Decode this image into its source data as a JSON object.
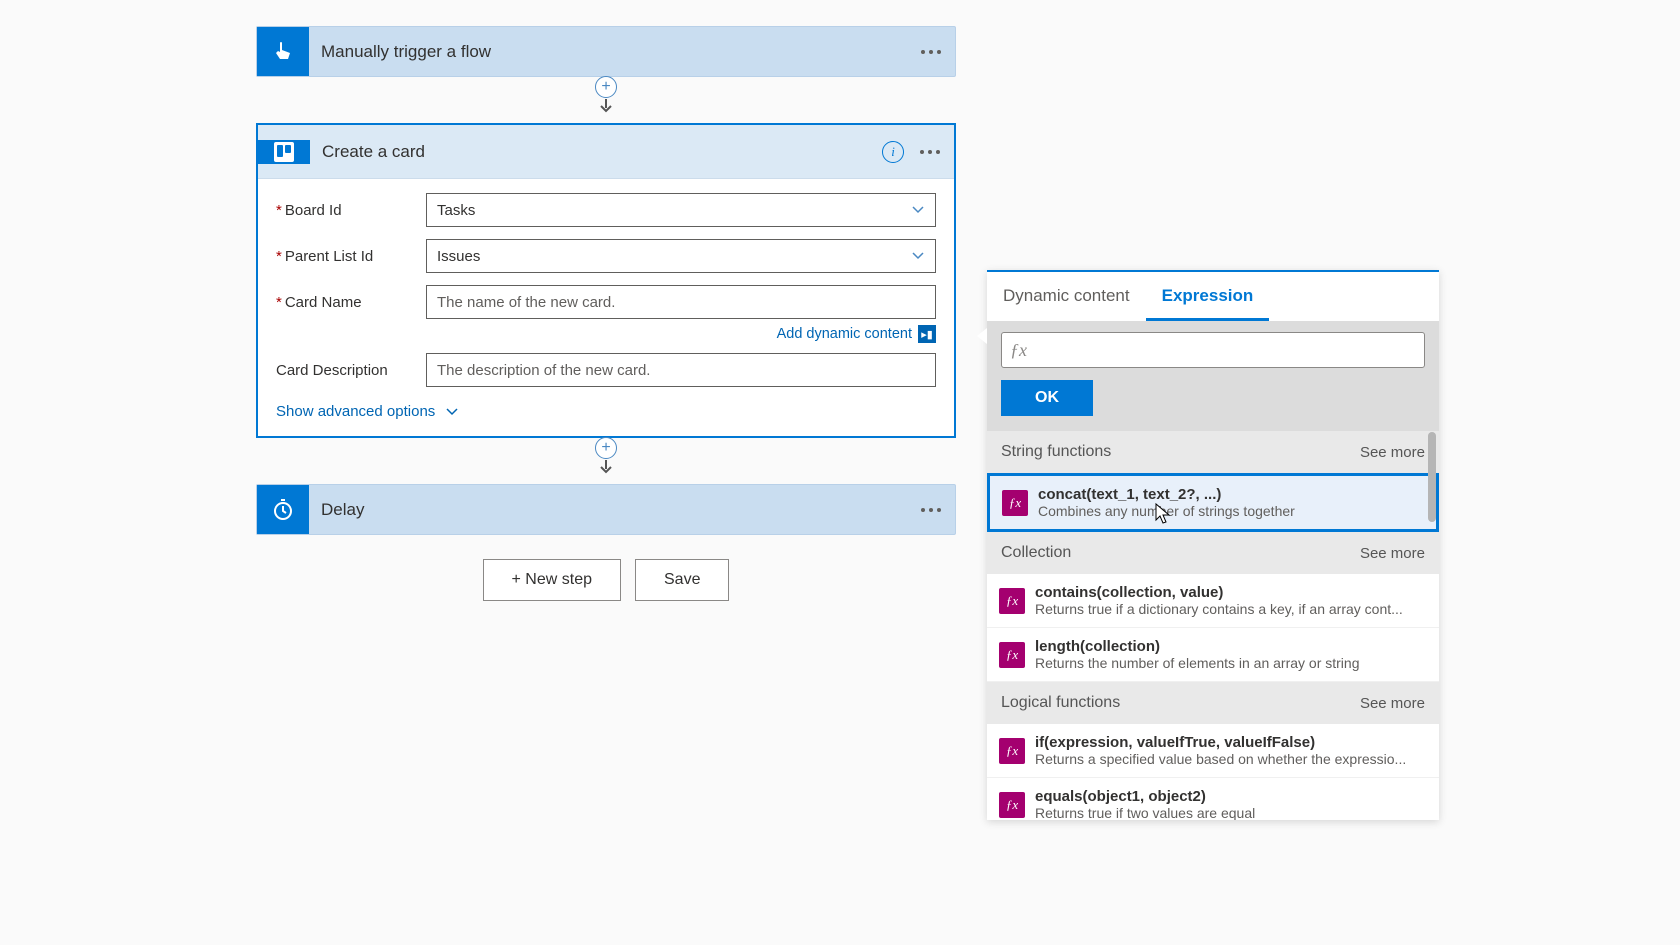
{
  "flow": {
    "trigger": {
      "title": "Manually trigger a flow"
    },
    "createCard": {
      "title": "Create a card",
      "fields": {
        "boardId": {
          "label": "Board Id",
          "value": "Tasks"
        },
        "parentListId": {
          "label": "Parent List Id",
          "value": "Issues"
        },
        "cardName": {
          "label": "Card Name",
          "placeholder": "The name of the new card."
        },
        "cardDescription": {
          "label": "Card Description",
          "placeholder": "The description of the new card."
        }
      },
      "addDynamic": "Add dynamic content",
      "advanced": "Show advanced options"
    },
    "delay": {
      "title": "Delay"
    },
    "buttons": {
      "newStep": "+ New step",
      "save": "Save"
    }
  },
  "expr": {
    "tabs": {
      "dynamic": "Dynamic content",
      "expression": "Expression"
    },
    "ok": "OK",
    "seeMore": "See more",
    "categories": {
      "string": "String functions",
      "collection": "Collection",
      "logical": "Logical functions"
    },
    "fns": {
      "concat": {
        "name": "concat(text_1, text_2?, ...)",
        "desc": "Combines any number of strings together"
      },
      "contains": {
        "name": "contains(collection, value)",
        "desc": "Returns true if a dictionary contains a key, if an array cont..."
      },
      "length": {
        "name": "length(collection)",
        "desc": "Returns the number of elements in an array or string"
      },
      "if": {
        "name": "if(expression, valueIfTrue, valueIfFalse)",
        "desc": "Returns a specified value based on whether the expressio..."
      },
      "equals": {
        "name": "equals(object1, object2)",
        "desc": "Returns true if two values are equal"
      }
    }
  }
}
